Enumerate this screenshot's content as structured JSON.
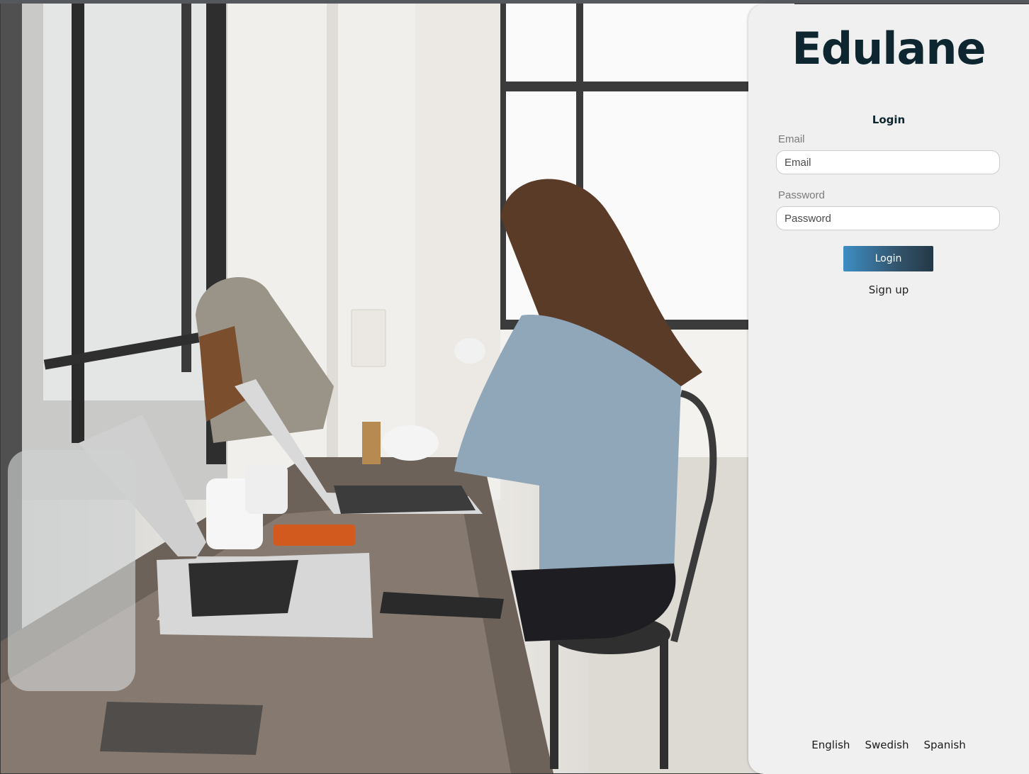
{
  "brand": {
    "name": "Edulane"
  },
  "hero_image": {
    "description_icon": "woman-working-cafe-photo"
  },
  "login": {
    "heading": "Login",
    "email": {
      "label": "Email",
      "placeholder": "Email",
      "value": ""
    },
    "password": {
      "label": "Password",
      "placeholder": "Password",
      "value": ""
    },
    "submit_label": "Login",
    "signup_label": "Sign up"
  },
  "languages": [
    "English",
    "Swedish",
    "Spanish"
  ],
  "colors": {
    "brand_text": "#0e2630",
    "panel_bg": "#f1f0f0",
    "button_gradient_start": "#3d8ec4",
    "button_gradient_end": "#243846"
  }
}
